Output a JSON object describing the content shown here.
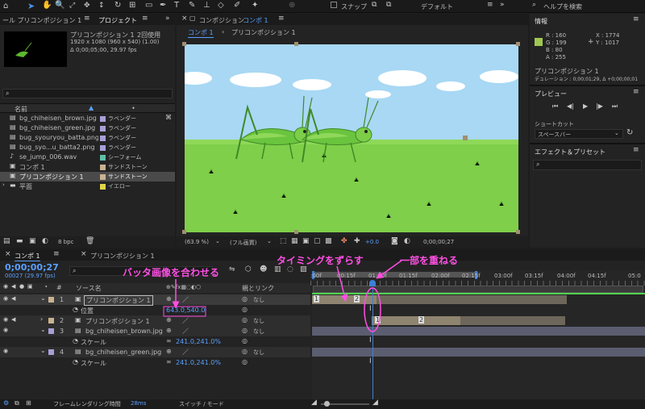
{
  "toolbar": {
    "panel_title_left": "ール プリコンポジション 1",
    "snap_label": "スナップ",
    "workspace_label": "デフォルト",
    "help_placeholder": "ヘルプを検索"
  },
  "project_panel": {
    "tab_project": "プロジェクト",
    "comp_name": "プリコンポジション 1",
    "used_count": "2回使用",
    "size_info": "1920 x 1080 (960 x 540) (1.00)",
    "duration_info": "Δ 0;00;05;00, 29.97 fps",
    "col_name": "名前",
    "items": [
      {
        "name": "bg_chiheisen_brown.jpg",
        "label": "ラベンダー",
        "color": "#a6a0d6",
        "type": "image"
      },
      {
        "name": "bg_chiheisen_green.jpg",
        "label": "ラベンダー",
        "color": "#a6a0d6",
        "type": "image"
      },
      {
        "name": "bug_syouryou_batta.png",
        "label": "ラベンダー",
        "color": "#a6a0d6",
        "type": "image"
      },
      {
        "name": "bug_syo...u_batta2.png",
        "label": "ラベンダー",
        "color": "#a6a0d6",
        "type": "image"
      },
      {
        "name": "se_jump_006.wav",
        "label": "シーフォーム",
        "color": "#5fc0a8",
        "type": "audio"
      },
      {
        "name": "コンポ 1",
        "label": "サンドストーン",
        "color": "#c8b290",
        "type": "comp"
      },
      {
        "name": "プリコンポジション 1",
        "label": "サンドストーン",
        "color": "#c8b290",
        "type": "comp"
      },
      {
        "name": "平面",
        "label": "イエロー",
        "color": "#e0d44a",
        "type": "folder"
      }
    ],
    "bpc": "8 bpc"
  },
  "comp_panel": {
    "title_prefix": "コンポジション",
    "title_comp": "コンポ 1",
    "breadcrumb_1": "コンポ 1",
    "breadcrumb_2": "プリコンポジション 1",
    "zoom": "(63.9 %)",
    "quality": "(フル画質)",
    "exposure": "+0.0",
    "timecode": "0;00;00;27"
  },
  "info_panel": {
    "title": "情報",
    "r": "R : 160",
    "g": "G : 199",
    "b": "B : 80",
    "a": "A : 255",
    "x": "X : 1774",
    "y": "Y : 1017",
    "swatch_color": "#a0c750",
    "comp_name": "プリコンポジション 1",
    "duration": "デュレーション : 0;00;01;29, Δ +0;00;00;01"
  },
  "preview_panel": {
    "title": "プレビュー",
    "shortcut_label": "ショートカット",
    "shortcut_value": "スペースバー"
  },
  "effects_panel": {
    "title": "エフェクト＆プリセット"
  },
  "timeline": {
    "tab_comp": "コンポ 1",
    "tab_precomp": "プリコンポジション 1",
    "timecode": "0;00;00;27",
    "frame_info": "00027 (29.97 fps)",
    "col_source": "ソース名",
    "col_parent": "親とリンク",
    "ruler_labels": [
      ":00f",
      "00:15f",
      "01:00f",
      "01:15f",
      "02:00f",
      "02:15f",
      "03:00f",
      "03:15f",
      "04:00f",
      "04:15f",
      "05:0"
    ],
    "layers": [
      {
        "num": "1",
        "name": "プリコンポジション 1",
        "color": "#c8b290",
        "parent": "なし",
        "boxed": true
      },
      {
        "prop": "位置",
        "value": "643.0,540.0"
      },
      {
        "num": "2",
        "name": "プリコンポジション 1",
        "color": "#c8b290",
        "parent": "なし",
        "boxed": false
      },
      {
        "num": "3",
        "name": "bg_chiheisen_brown.jpg",
        "color": "#a6a0d6",
        "parent": "なし",
        "boxed": false
      },
      {
        "prop": "スケール",
        "value": "241.0,241.0%"
      },
      {
        "num": "4",
        "name": "bg_chiheisen_green.jpg",
        "color": "#a6a0d6",
        "parent": "なし",
        "boxed": false
      },
      {
        "prop": "スケール",
        "value": "241.0,241.0%"
      }
    ],
    "footer_render_label": "フレームレンダリング時間",
    "footer_render_value": "28ms",
    "footer_switch": "スイッチ / モード"
  },
  "annotations": {
    "align": "バッタ画像を合わせる",
    "timing": "タイミングをずらす",
    "overlap": "一部を重ねる"
  }
}
